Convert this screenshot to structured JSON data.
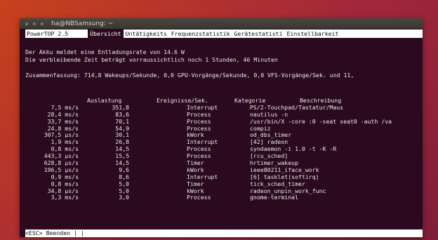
{
  "window": {
    "title": "ha@NBSamsung: ~"
  },
  "tabs": {
    "app": "PowerTOP 2.5",
    "items": [
      "Übersicht",
      "Untätigkeits",
      "Frequenzstatistik",
      "Gerätestatisti",
      "Einstellbarkeit"
    ],
    "active_index": 0
  },
  "messages": {
    "line1": "Der Akku meldet eine Entladungsrate von 14.6 W",
    "line2": "Die verbleibende Zeit beträgt vorraussichtlich noch 1 Stunden, 46 Minuten",
    "summary": "Zusammenfassung: 714,8 Wakeups/Sekunde, 0,0 GPU-Vorgänge/Sekunde, 0,0 VFS-Vorgänge/Sek. und 11,"
  },
  "table": {
    "headers": [
      "Auslastung",
      "Ereignisse/Sek.",
      "Kategorie",
      "Beschreibung"
    ],
    "rows": [
      [
        "7,5 ms/s",
        "351,8",
        "Interrupt",
        "PS/2-Touchpad/Tastatur/Maus"
      ],
      [
        "28,4 ms/s",
        "83,6",
        "Process",
        "nautilus -n"
      ],
      [
        "33,7 ms/s",
        "70,1",
        "Process",
        "/usr/bin/X -core :0 -seat seat0 -auth /va"
      ],
      [
        "24,8 ms/s",
        "54,9",
        "Process",
        "compiz"
      ],
      [
        "307,5 µs/s",
        "30,1",
        "kWork",
        "od_dbs_timer"
      ],
      [
        "1,9 ms/s",
        "26,8",
        "Interrupt",
        "[42] radeon"
      ],
      [
        "0,8 ms/s",
        "14,5",
        "Process",
        "syndaemon -i 1.0 -t -K -R"
      ],
      [
        "443,3 µs/s",
        "15,5",
        "Process",
        "[rcu_sched]"
      ],
      [
        "628,8 µs/s",
        "14,5",
        "Timer",
        "hrtimer_wakeup"
      ],
      [
        "196,5 µs/s",
        "9,6",
        "kWork",
        "ieee80211_iface_work"
      ],
      [
        "0,9 ms/s",
        "8,6",
        "Interrupt",
        "[6] tasklet(softirq)"
      ],
      [
        "0,8 ms/s",
        "5,0",
        "Timer",
        "tick_sched_timer"
      ],
      [
        "34,8 µs/s",
        "5,0",
        "kWork",
        "radeon_unpin_work_func"
      ],
      [
        "3,3 ms/s",
        "3,0",
        "Process",
        "gnome-terminal"
      ]
    ]
  },
  "statusbar": {
    "text": "<ESC> Beenden | |"
  },
  "colors": {
    "terminal_bg": "#2b0a1f",
    "terminal_fg": "#e8e8e8",
    "bar_bg": "#ffffff",
    "wallpaper_start": "#c8421c",
    "wallpaper_end": "#7f1f38"
  }
}
